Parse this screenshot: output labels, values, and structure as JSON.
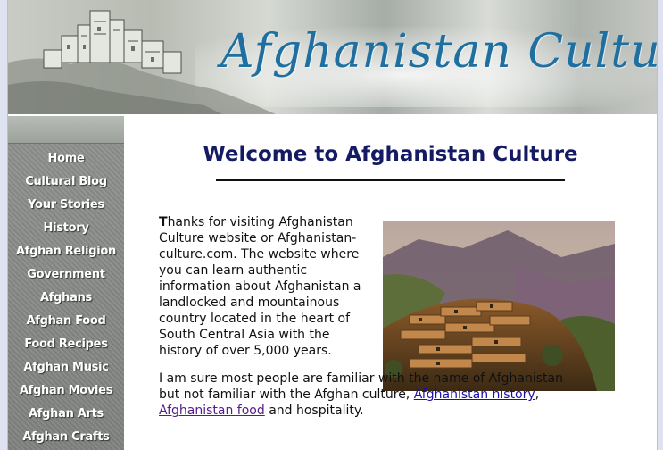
{
  "header": {
    "site_title": "Afghanistan Culture"
  },
  "sidebar": {
    "items": [
      {
        "label": "Home"
      },
      {
        "label": "Cultural Blog"
      },
      {
        "label": "Your Stories"
      },
      {
        "label": "History"
      },
      {
        "label": "Afghan Religion"
      },
      {
        "label": "Government"
      },
      {
        "label": "Afghans"
      },
      {
        "label": "Afghan Food"
      },
      {
        "label": "Food Recipes"
      },
      {
        "label": "Afghan Music"
      },
      {
        "label": "Afghan Movies"
      },
      {
        "label": "Afghan Arts"
      },
      {
        "label": "Afghan Crafts"
      }
    ]
  },
  "main": {
    "title": "Welcome to Afghanistan Culture",
    "intro": {
      "first_letter": "T",
      "rest": "hanks for visiting Afghanistan Culture website or Afghanistan-culture.com. The website where you can learn authentic information about Afghanistan a landlocked and mountainous country located in the heart of South Central Asia with the history of over 5,000 years."
    },
    "second": {
      "text_before": "I am sure most people are familiar with the name of Afghanistan but not familiar with the Afghan culture, ",
      "link_history": "Afghanistan history",
      "sep": ", ",
      "link_food": "Afghanistan food",
      "text_after": " and hospitality."
    }
  }
}
